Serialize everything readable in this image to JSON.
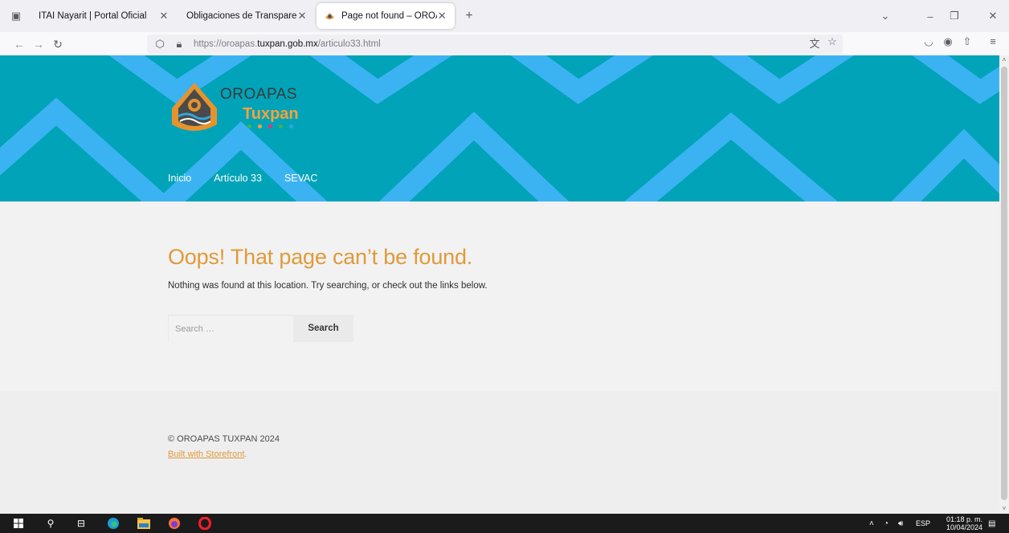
{
  "browser": {
    "tabs": [
      {
        "title": "ITAI Nayarit | Portal Oficial",
        "active": false
      },
      {
        "title": "Obligaciones de Transparencia S.O.",
        "active": false
      },
      {
        "title": "Page not found – OROAPAS TU",
        "active": true
      }
    ],
    "url_prefix": "https://oroapas.",
    "url_domain": "tuxpan.gob.mx",
    "url_path": "/articulo33.html"
  },
  "site": {
    "logo_line1": "OROAPAS",
    "logo_line2": "Tuxpan",
    "nav": [
      "Inicio",
      "Artículo 33",
      "SEVAC"
    ],
    "colors": {
      "header_bg": "#00a3b8",
      "chevron": "#3bb3f2",
      "accent": "#e09a3a"
    }
  },
  "content": {
    "title": "Oops! That page can’t be found.",
    "message": "Nothing was found at this location. Try searching, or check out the links below.",
    "search_placeholder": "Search …",
    "search_button": "Search"
  },
  "footer": {
    "copyright": "© OROAPAS TUXPAN 2024",
    "built_with": "Built with Storefront"
  },
  "taskbar": {
    "language": "ESP",
    "time": "01:18 p. m.",
    "date": "10/04/2024"
  }
}
